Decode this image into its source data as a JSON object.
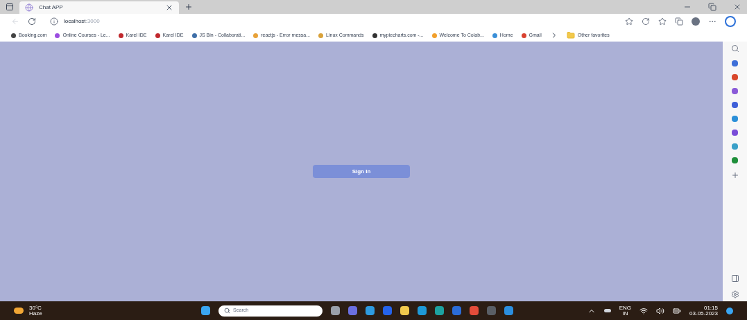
{
  "tab": {
    "title": "Chat APP",
    "selected": true
  },
  "address": {
    "host": "localhost",
    "port": ":3000"
  },
  "bookmarks": [
    {
      "label": "Booking.com",
      "color": "#444444"
    },
    {
      "label": "Online Courses - Le...",
      "color": "#9b4de0"
    },
    {
      "label": "Karel IDE",
      "color": "#c0282d"
    },
    {
      "label": "Karel IDE",
      "color": "#c0282d"
    },
    {
      "label": "JS Bin - Collaborati...",
      "color": "#3f6fa8"
    },
    {
      "label": "reactjs - Error messa...",
      "color": "#e8a23a"
    },
    {
      "label": "Linux Commands",
      "color": "#d9a23a"
    },
    {
      "label": "mypiecharts.com -...",
      "color": "#333333"
    },
    {
      "label": "Welcome To Colab...",
      "color": "#f2a02c"
    },
    {
      "label": "Home",
      "color": "#3a8fd8"
    },
    {
      "label": "Gmail",
      "color": "#d9412f"
    }
  ],
  "other_favorites": "Other favorites",
  "sign_in": "Sign In",
  "sidebar_icons": [
    {
      "color": "#3e6fd8"
    },
    {
      "color": "#d9472b"
    },
    {
      "color": "#8a5ad8"
    },
    {
      "color": "#3e5fd8"
    },
    {
      "color": "#2b8fd8"
    },
    {
      "color": "#7a4dd8"
    },
    {
      "color": "#3aa0c8"
    },
    {
      "color": "#1f8f3a"
    }
  ],
  "taskbar": {
    "temperature": "30°C",
    "weather": "Haze",
    "search_placeholder": "Search",
    "language": "ENG",
    "region": "IN",
    "time": "01:15",
    "date": "03-05-2023"
  }
}
